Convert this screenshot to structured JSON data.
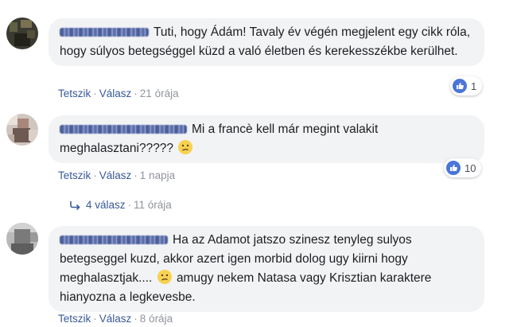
{
  "comments": [
    {
      "text": "Tuti, hogy Ádám! Tavaly év végén megjelent egy cikk róla, hogy súlyos betegséggel küzd a való életben és kerekesszékbe kerülhet.",
      "like_label": "Tetszik",
      "reply_label": "Válasz",
      "time": "21 órája",
      "reaction_count": "1"
    },
    {
      "text_before_emoji": "Mi a francè kell már megint valakit meghalasztani?????",
      "like_label": "Tetszik",
      "reply_label": "Válasz",
      "time": "1 napja",
      "reaction_count": "10",
      "replies_label": "4 válasz",
      "replies_time": "11 órája"
    },
    {
      "text_before_emoji": "Ha az Adamot jatszo szinesz tenyleg sulyos betegseggel kuzd, akkor azert igen morbid dolog ugy kiirni hogy meghalasztjak....",
      "text_after_emoji": "amugy nekem Natasa vagy Krisztian karaktere hianyozna a legkevesbe.",
      "like_label": "Tetszik",
      "reply_label": "Válasz",
      "time": "8 órája"
    }
  ],
  "separator": "·",
  "colors": {
    "bubble": "#f2f3f5",
    "link": "#385898",
    "meta": "#90949c",
    "like_blue": "#4a75d9",
    "emoji_yellow": "#f7d250"
  },
  "icons": [
    "like-icon",
    "reply-arrow-icon",
    "confused-face-icon"
  ]
}
